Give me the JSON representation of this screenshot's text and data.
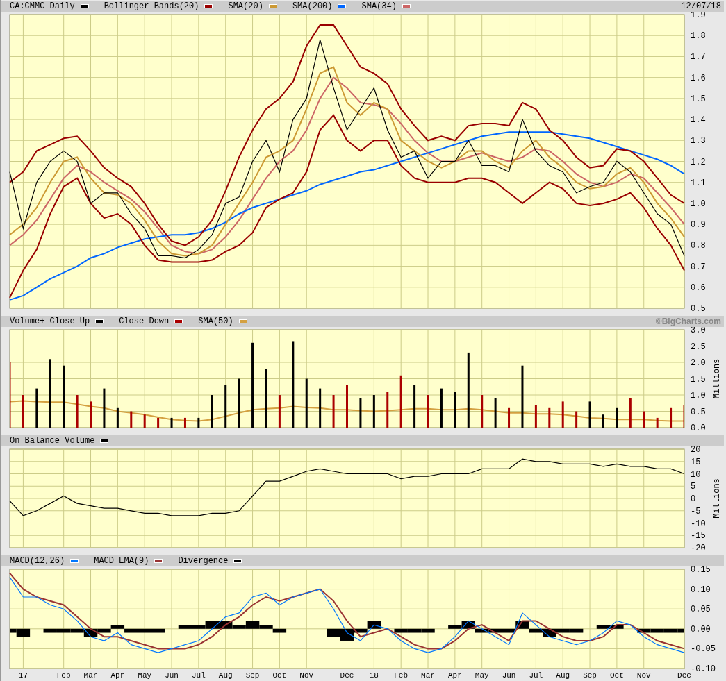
{
  "panels": [
    {
      "header_right": "12/07/18",
      "chart_data": {
        "type": "line",
        "grid": true,
        "categories": [
          null,
          null,
          null,
          null,
          null,
          null,
          null,
          null,
          null,
          null,
          null,
          null,
          null,
          null,
          null,
          null,
          null,
          null,
          null,
          null,
          null,
          null,
          null,
          null,
          null,
          null,
          null,
          null,
          null,
          null,
          null,
          null,
          null,
          null,
          null,
          null,
          null,
          null,
          null,
          null,
          null,
          null,
          null,
          null,
          null,
          null,
          null,
          null,
          null,
          null,
          null
        ],
        "ylim": [
          0.5,
          1.9
        ],
        "yticks": [
          {
            "value": 0.5,
            "label": "0.5"
          },
          {
            "value": 0.6,
            "label": "0.6"
          },
          {
            "value": 0.7,
            "label": "0.7"
          },
          {
            "value": 0.8,
            "label": "0.8"
          },
          {
            "value": 0.9,
            "label": "0.9"
          },
          {
            "value": 1.0,
            "label": "1.0"
          },
          {
            "value": 1.1,
            "label": "1.1"
          },
          {
            "value": 1.2,
            "label": "1.2"
          },
          {
            "value": 1.3,
            "label": "1.3"
          },
          {
            "value": 1.4,
            "label": "1.4"
          },
          {
            "value": 1.5,
            "label": "1.5"
          },
          {
            "value": 1.6,
            "label": "1.6"
          },
          {
            "value": 1.7,
            "label": "1.7"
          },
          {
            "value": 1.8,
            "label": "1.8"
          },
          {
            "value": 1.9,
            "label": "1.9"
          }
        ],
        "series": [
          {
            "name": "CA:CMMC Daily",
            "color": "#000000",
            "values": [
              1.15,
              0.88,
              1.1,
              1.2,
              1.25,
              1.2,
              1.0,
              1.05,
              1.05,
              0.95,
              0.88,
              0.75,
              0.75,
              0.74,
              0.78,
              0.85,
              1.0,
              1.03,
              1.2,
              1.3,
              1.15,
              1.4,
              1.5,
              1.78,
              1.55,
              1.35,
              1.45,
              1.55,
              1.35,
              1.22,
              1.25,
              1.12,
              1.2,
              1.2,
              1.3,
              1.18,
              1.18,
              1.15,
              1.4,
              1.25,
              1.18,
              1.15,
              1.05,
              1.08,
              1.1,
              1.2,
              1.15,
              1.05,
              0.95,
              0.9,
              0.75
            ]
          },
          {
            "name": "Bollinger Bands(20)",
            "color": "#990000",
            "values": [
              1.1,
              1.15,
              1.25,
              1.28,
              1.31,
              1.32,
              1.25,
              1.17,
              1.12,
              1.08,
              1.0,
              0.9,
              0.82,
              0.8,
              0.84,
              0.92,
              1.06,
              1.22,
              1.35,
              1.45,
              1.5,
              1.58,
              1.75,
              1.85,
              1.85,
              1.75,
              1.65,
              1.62,
              1.57,
              1.45,
              1.37,
              1.3,
              1.32,
              1.3,
              1.37,
              1.38,
              1.38,
              1.37,
              1.48,
              1.45,
              1.35,
              1.3,
              1.22,
              1.17,
              1.18,
              1.26,
              1.25,
              1.2,
              1.12,
              1.04,
              1.0
            ]
          },
          {
            "color": "#990000",
            "values": [
              0.55,
              0.68,
              0.78,
              0.95,
              1.08,
              1.12,
              1.0,
              0.93,
              0.95,
              0.9,
              0.8,
              0.73,
              0.72,
              0.72,
              0.72,
              0.73,
              0.77,
              0.8,
              0.86,
              0.98,
              1.02,
              1.05,
              1.15,
              1.35,
              1.42,
              1.3,
              1.25,
              1.3,
              1.3,
              1.18,
              1.12,
              1.1,
              1.1,
              1.1,
              1.12,
              1.12,
              1.1,
              1.05,
              1.0,
              1.05,
              1.1,
              1.07,
              1.0,
              0.99,
              1.0,
              1.02,
              1.05,
              0.98,
              0.88,
              0.8,
              0.68
            ]
          },
          {
            "name": "SMA(20)",
            "color": "#cc9933",
            "values": [
              0.85,
              0.9,
              0.98,
              1.1,
              1.2,
              1.22,
              1.12,
              1.05,
              1.04,
              1.0,
              0.92,
              0.82,
              0.76,
              0.75,
              0.76,
              0.8,
              0.9,
              1.0,
              1.1,
              1.22,
              1.25,
              1.3,
              1.45,
              1.62,
              1.65,
              1.48,
              1.42,
              1.48,
              1.45,
              1.3,
              1.25,
              1.2,
              1.17,
              1.2,
              1.25,
              1.25,
              1.2,
              1.17,
              1.25,
              1.3,
              1.22,
              1.17,
              1.1,
              1.07,
              1.08,
              1.14,
              1.17,
              1.1,
              1.0,
              0.93,
              0.84
            ]
          },
          {
            "name": "SMA(200)",
            "color": "#0066ff",
            "values": [
              0.54,
              0.56,
              0.6,
              0.64,
              0.67,
              0.7,
              0.74,
              0.76,
              0.79,
              0.81,
              0.83,
              0.84,
              0.85,
              0.85,
              0.86,
              0.88,
              0.91,
              0.95,
              0.98,
              1.0,
              1.02,
              1.04,
              1.06,
              1.09,
              1.11,
              1.13,
              1.15,
              1.16,
              1.18,
              1.2,
              1.22,
              1.24,
              1.26,
              1.28,
              1.3,
              1.32,
              1.33,
              1.34,
              1.34,
              1.34,
              1.34,
              1.33,
              1.32,
              1.31,
              1.29,
              1.27,
              1.25,
              1.23,
              1.21,
              1.18,
              1.14
            ]
          },
          {
            "name": "SMA(34)",
            "color": "#cc6666",
            "values": [
              0.8,
              0.85,
              0.92,
              1.02,
              1.12,
              1.18,
              1.15,
              1.1,
              1.06,
              1.02,
              0.96,
              0.88,
              0.8,
              0.77,
              0.76,
              0.78,
              0.84,
              0.92,
              1.02,
              1.12,
              1.2,
              1.25,
              1.35,
              1.5,
              1.6,
              1.55,
              1.48,
              1.47,
              1.45,
              1.38,
              1.3,
              1.24,
              1.2,
              1.2,
              1.22,
              1.24,
              1.22,
              1.2,
              1.22,
              1.26,
              1.25,
              1.2,
              1.14,
              1.1,
              1.08,
              1.1,
              1.14,
              1.12,
              1.05,
              0.98,
              0.9
            ]
          }
        ]
      }
    },
    {
      "header_right": "©BigCharts.com",
      "chart_data": {
        "type": "bar",
        "grid": true,
        "ylabel": "Millions",
        "categories": [
          null,
          null,
          null,
          null,
          null,
          null,
          null,
          null,
          null,
          null,
          null,
          null,
          null,
          null,
          null,
          null,
          null,
          null,
          null,
          null,
          null,
          null,
          null,
          null,
          null,
          null,
          null,
          null,
          null,
          null,
          null,
          null,
          null,
          null,
          null,
          null,
          null,
          null,
          null,
          null,
          null,
          null,
          null,
          null,
          null,
          null,
          null,
          null,
          null,
          null,
          null
        ],
        "ylim": [
          0,
          3
        ],
        "yticks": [
          {
            "value": 0,
            "label": "0.0"
          },
          {
            "value": 0.5,
            "label": "0.5"
          },
          {
            "value": 1,
            "label": "1.0"
          },
          {
            "value": 1.5,
            "label": "1.5"
          },
          {
            "value": 2,
            "label": "2.0"
          },
          {
            "value": 2.5,
            "label": "2.5"
          },
          {
            "value": 3,
            "label": "3.0"
          }
        ],
        "series": [
          {
            "name": "Volume+ Close Up",
            "color": "#000000",
            "values": [
              null,
              null,
              1.2,
              2.1,
              1.9,
              null,
              null,
              1.2,
              0.6,
              null,
              null,
              null,
              0.3,
              null,
              0.3,
              1.0,
              1.3,
              1.5,
              2.6,
              1.8,
              null,
              2.65,
              1.5,
              1.2,
              null,
              null,
              0.9,
              1.0,
              null,
              null,
              1.3,
              null,
              1.2,
              1.1,
              2.3,
              null,
              0.9,
              null,
              1.9,
              null,
              null,
              null,
              null,
              0.8,
              0.4,
              0.6,
              null,
              null,
              null,
              null,
              null
            ]
          },
          {
            "name": "Close Down",
            "color": "#aa0000",
            "values": [
              2.0,
              1.0,
              null,
              null,
              null,
              1.0,
              0.8,
              null,
              null,
              0.5,
              0.4,
              0.3,
              null,
              0.3,
              null,
              null,
              null,
              null,
              null,
              null,
              1.0,
              null,
              null,
              null,
              1.0,
              1.3,
              null,
              null,
              1.1,
              1.6,
              null,
              1.0,
              null,
              null,
              null,
              1.0,
              null,
              0.6,
              null,
              0.7,
              0.6,
              0.8,
              0.5,
              null,
              null,
              null,
              0.9,
              0.5,
              0.3,
              0.6,
              0.7
            ]
          },
          {
            "name": "SMA(50)",
            "color": "#d4a040",
            "type": "line",
            "values": [
              0.8,
              0.82,
              0.8,
              0.78,
              0.78,
              0.72,
              0.65,
              0.6,
              0.5,
              0.45,
              0.4,
              0.32,
              0.25,
              0.22,
              0.2,
              0.25,
              0.35,
              0.45,
              0.55,
              0.58,
              0.6,
              0.65,
              0.62,
              0.6,
              0.55,
              0.55,
              0.52,
              0.5,
              0.52,
              0.55,
              0.58,
              0.58,
              0.55,
              0.55,
              0.58,
              0.55,
              0.5,
              0.45,
              0.45,
              0.42,
              0.42,
              0.4,
              0.35,
              0.3,
              0.28,
              0.25,
              0.25,
              0.25,
              0.22,
              0.2,
              0.2
            ]
          }
        ]
      }
    },
    {
      "chart_data": {
        "type": "line",
        "grid": true,
        "ylabel": "Millions",
        "categories": [
          null,
          null,
          null,
          null,
          null,
          null,
          null,
          null,
          null,
          null,
          null,
          null,
          null,
          null,
          null,
          null,
          null,
          null,
          null,
          null,
          null,
          null,
          null,
          null,
          null,
          null,
          null,
          null,
          null,
          null,
          null,
          null,
          null,
          null,
          null,
          null,
          null,
          null,
          null,
          null,
          null,
          null,
          null,
          null,
          null,
          null,
          null,
          null,
          null,
          null,
          null
        ],
        "ylim": [
          -20,
          20
        ],
        "yticks": [
          -20,
          -15,
          -10,
          -5,
          0,
          5,
          10,
          15,
          20
        ],
        "series": [
          {
            "name": "On Balance Volume",
            "color": "#000000",
            "values": [
              -1,
              -7,
              -5,
              -2,
              1,
              -2,
              -3,
              -4,
              -4,
              -5,
              -6,
              -6,
              -7,
              -7,
              -7,
              -6,
              -6,
              -5,
              1,
              7,
              7,
              9,
              11,
              12,
              11,
              10,
              10,
              10,
              10,
              8,
              9,
              9,
              10,
              10,
              10,
              12,
              12,
              12,
              16,
              15,
              15,
              14,
              14,
              14,
              13,
              14,
              13,
              13,
              12,
              12,
              10
            ]
          }
        ]
      }
    },
    {
      "chart_data": {
        "type": "line",
        "grid": true,
        "categories": [
          null,
          "17",
          null,
          null,
          "Feb",
          null,
          "Mar",
          null,
          "Apr",
          null,
          "May",
          null,
          "Jun",
          null,
          "Jul",
          null,
          "Aug",
          null,
          "Sep",
          null,
          "Oct",
          null,
          "Nov",
          null,
          null,
          "Dec",
          null,
          "18",
          null,
          "Feb",
          null,
          "Mar",
          null,
          "Apr",
          null,
          "May",
          null,
          "Jun",
          null,
          "Jul",
          null,
          "Aug",
          null,
          "Sep",
          null,
          "Oct",
          null,
          "Nov",
          null,
          null,
          "Dec"
        ],
        "ylim": [
          -0.1,
          0.15
        ],
        "yticks": [
          {
            "value": -0.1,
            "label": "-0.10"
          },
          {
            "value": -0.05,
            "label": "-0.05"
          },
          {
            "value": 0,
            "label": "0.00"
          },
          {
            "value": 0.05,
            "label": "0.05"
          },
          {
            "value": 0.1,
            "label": "0.10"
          },
          {
            "value": 0.15,
            "label": "0.15"
          }
        ],
        "series": [
          {
            "name": "MACD(12,26)",
            "color": "#0077ff",
            "values": [
              0.13,
              0.08,
              0.08,
              0.06,
              0.05,
              0.02,
              -0.02,
              -0.03,
              -0.01,
              -0.04,
              -0.05,
              -0.06,
              -0.05,
              -0.04,
              -0.03,
              0,
              0.03,
              0.04,
              0.08,
              0.09,
              0.06,
              0.08,
              0.09,
              0.1,
              0.05,
              -0.01,
              -0.03,
              0.01,
              0,
              -0.03,
              -0.05,
              -0.06,
              -0.05,
              -0.02,
              0.02,
              0,
              -0.02,
              -0.04,
              0.04,
              0.01,
              -0.02,
              -0.03,
              -0.04,
              -0.03,
              -0.01,
              0.02,
              0.01,
              -0.02,
              -0.04,
              -0.05,
              -0.06
            ]
          },
          {
            "name": "MACD EMA(9)",
            "color": "#993333",
            "values": [
              0.14,
              0.1,
              0.08,
              0.07,
              0.06,
              0.03,
              0,
              -0.02,
              -0.02,
              -0.03,
              -0.04,
              -0.05,
              -0.05,
              -0.05,
              -0.04,
              -0.02,
              0.01,
              0.03,
              0.06,
              0.08,
              0.07,
              0.08,
              0.09,
              0.1,
              0.07,
              0.02,
              -0.02,
              -0.01,
              0,
              -0.02,
              -0.04,
              -0.05,
              -0.05,
              -0.03,
              0,
              0.01,
              -0.01,
              -0.03,
              0.02,
              0.02,
              0,
              -0.02,
              -0.03,
              -0.03,
              -0.02,
              0.01,
              0.01,
              -0.01,
              -0.03,
              -0.04,
              -0.05
            ]
          },
          {
            "name": "Divergence",
            "color": "#000000",
            "type": "bar",
            "values": [
              -0.01,
              -0.02,
              0,
              -0.01,
              -0.01,
              -0.01,
              -0.02,
              -0.01,
              0.01,
              -0.01,
              -0.01,
              -0.01,
              0,
              0.01,
              0.01,
              0.02,
              0.02,
              0.01,
              0.02,
              0.01,
              -0.01,
              0,
              0,
              0,
              -0.02,
              -0.03,
              -0.01,
              0.02,
              0,
              -0.01,
              -0.01,
              -0.01,
              0,
              0.01,
              0.02,
              -0.01,
              -0.01,
              -0.01,
              0.02,
              -0.01,
              -0.02,
              -0.01,
              -0.01,
              0,
              0.01,
              0.01,
              0,
              -0.01,
              -0.01,
              -0.01,
              -0.01
            ]
          }
        ]
      }
    }
  ]
}
